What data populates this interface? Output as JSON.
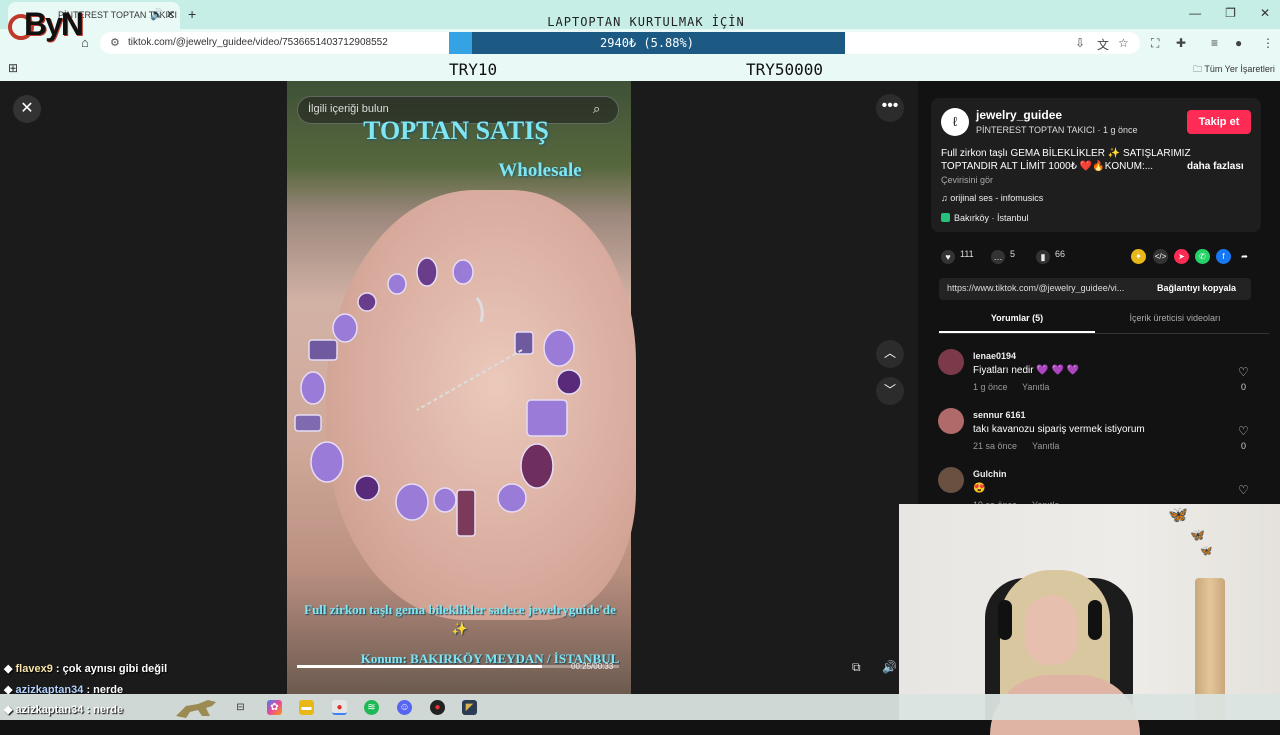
{
  "browser": {
    "tab_title": "PİNTEREST TOPTAN TAKICI",
    "url": "tiktok.com/@jewelry_guidee/video/7536651403712908552",
    "bookmarks_folder": "Tüm Yer İşaretleri"
  },
  "stream_overlay": {
    "logo_text": "ByN",
    "goal_title": "LAPTOPTAN KURTULMAK İÇİN",
    "goal_progress_text": "2940₺ (5.88%)",
    "goal_progress_fraction": 0.0588,
    "donation_min": "TRY10",
    "donation_max": "TRY50000",
    "accent_color": "#34a3e4"
  },
  "video": {
    "search_placeholder": "İlgili içeriği bulun",
    "caption_top": "TOPTAN SATIŞ",
    "caption_sub": "Wholesale",
    "caption_bottom": "Full zirkon taşlı gema bileklikler sadece jewelryguide'de ✨",
    "caption_location": "Konum: BAKIRKÖY MEYDAN / İSTANBUL",
    "time": "00:25/00:33",
    "progress_fraction": 0.76
  },
  "post": {
    "username": "jewelry_guidee",
    "subtitle": "PİNTEREST TOPTAN TAKICI · 1 g önce",
    "follow_label": "Takip et",
    "description": "Full zirkon taşlı GEMA BİLEKLİKLER ✨ SATIŞLARIMIZ TOPTANDIR ALT LİMİT 1000₺ ❤️🔥KONUM:...",
    "more_label": "daha fazlası",
    "translate_label": "Çevirisini gör",
    "music": "orijinal ses - infomusics",
    "location": "Bakırköy · İstanbul",
    "likes": "111",
    "comments": "5",
    "saves": "66",
    "link": "https://www.tiktok.com/@jewelry_guidee/vi...",
    "copy_label": "Bağlantıyı kopyala",
    "tab_comments": "Yorumlar (5)",
    "tab_creator": "İçerik üreticisi videoları"
  },
  "comments": [
    {
      "user": "lenae0194",
      "text": "Fiyatları nedir 💜 💜 💜",
      "time": "1 g önce",
      "reply": "Yanıtla",
      "likes": "0",
      "avatar_color": "#7a3a4a"
    },
    {
      "user": "sennur 6161",
      "text": "takı kavanozu sipariş vermek istiyorum",
      "time": "21 sa önce",
      "reply": "Yanıtla",
      "likes": "0",
      "avatar_color": "#b06a6a"
    },
    {
      "user": "Gulchin",
      "text": "😍",
      "time": "19 sa önce",
      "reply": "Yanıtla",
      "likes": "0",
      "avatar_color": "#6a5040"
    }
  ],
  "chat": [
    {
      "user": "flavex9",
      "message": "çok aynısı gibi değil"
    },
    {
      "user": "azizkaptan34",
      "message": "nerde"
    },
    {
      "user": "azizkaptan34",
      "message": "nerde"
    }
  ]
}
